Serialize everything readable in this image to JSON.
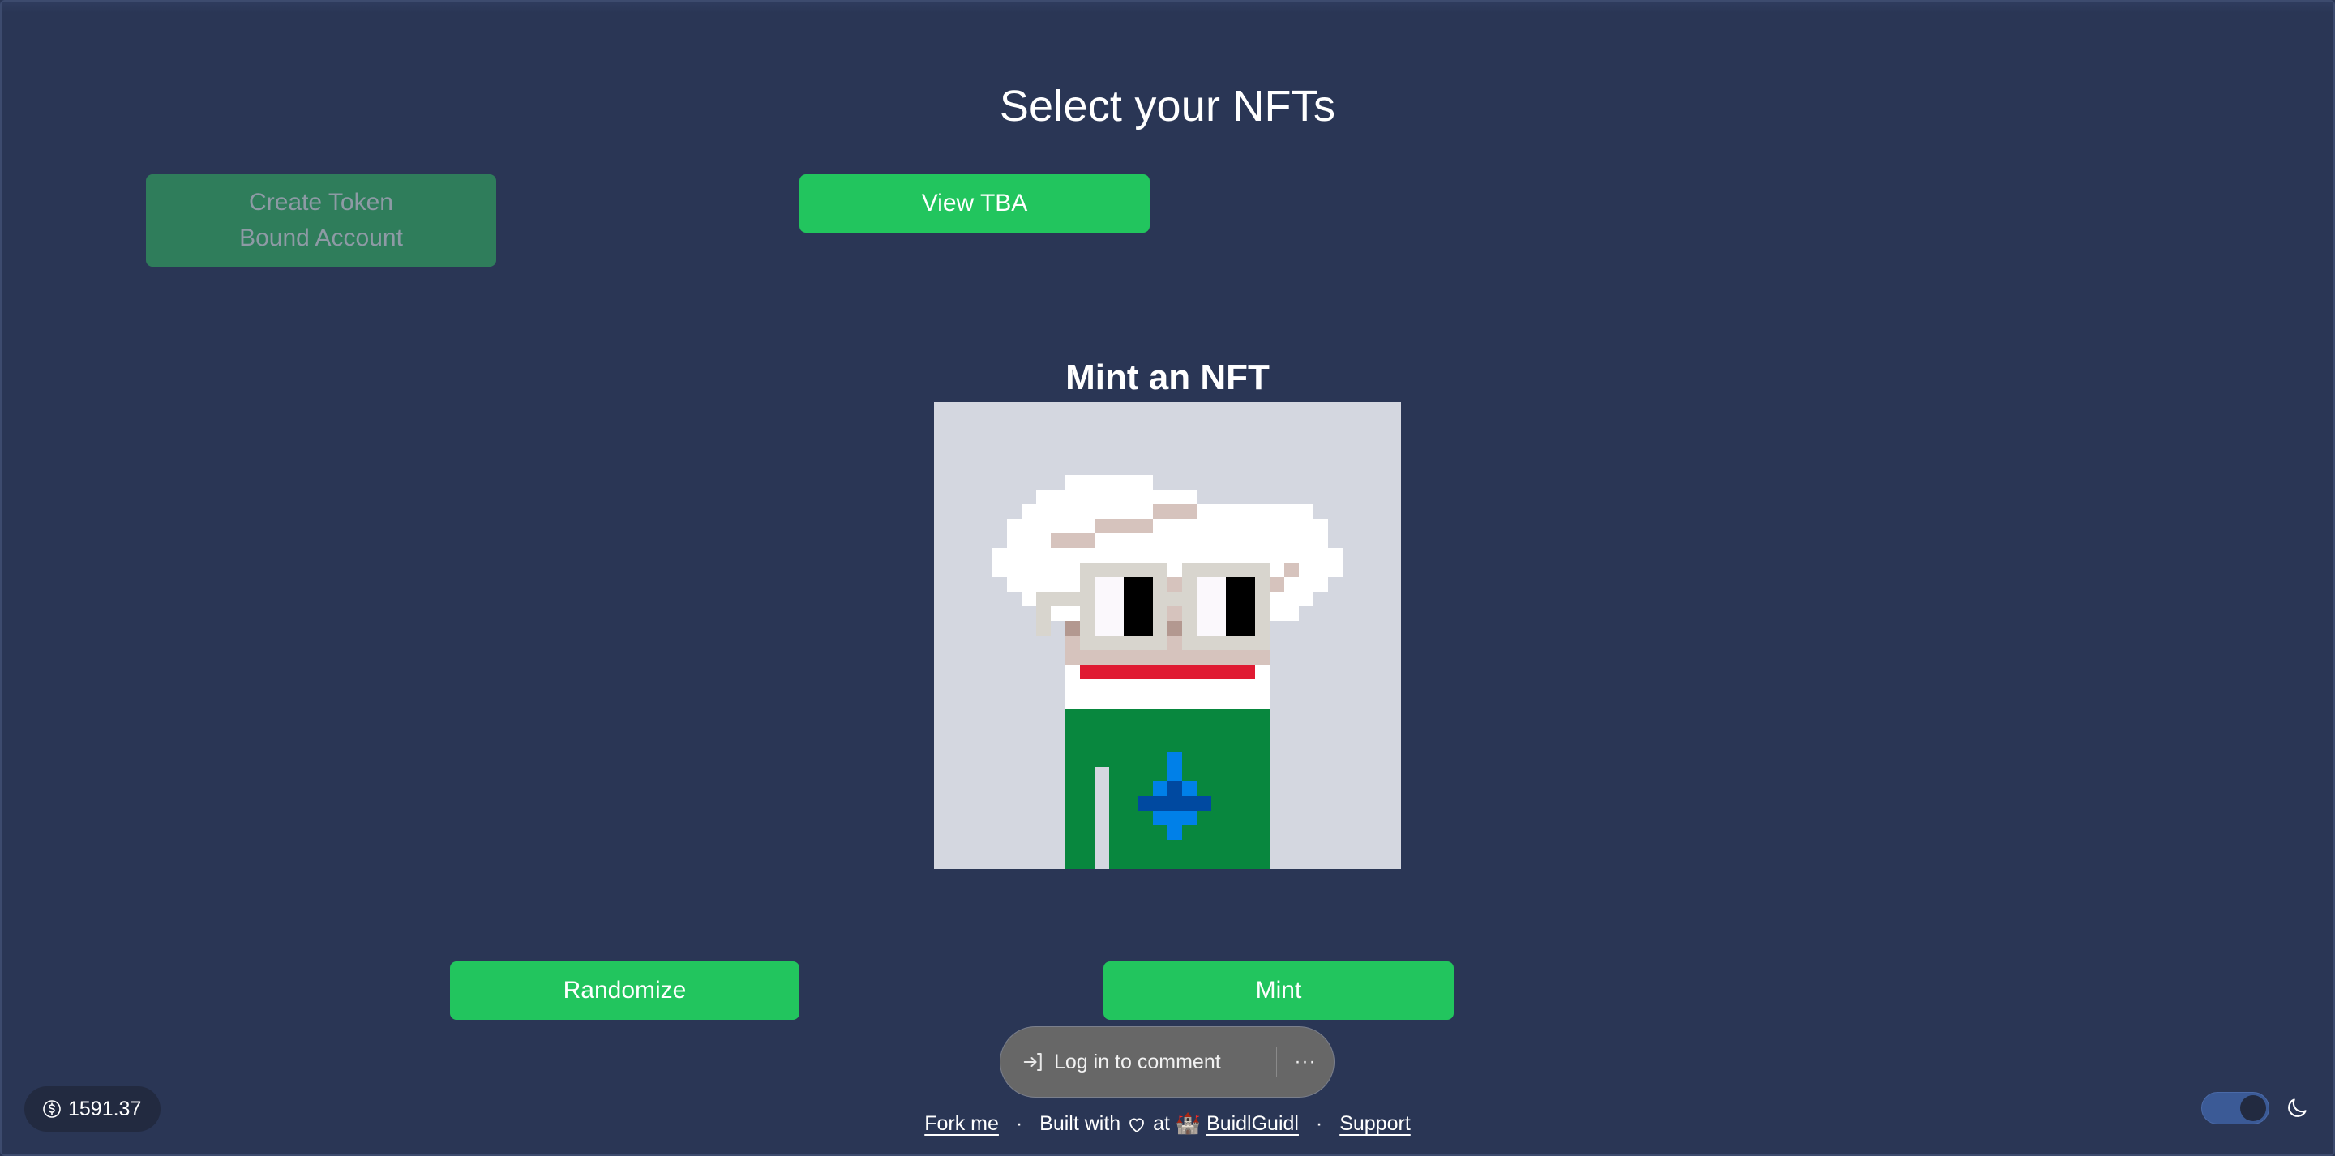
{
  "page": {
    "title": "Select your NFTs",
    "subtitle": "Mint an NFT"
  },
  "buttons": {
    "create_tba": "Create Token Bound Account",
    "create_tba_line1": "Create Token",
    "create_tba_line2": "Bound Account",
    "view_tba": "View TBA",
    "randomize": "Randomize",
    "mint": "Mint"
  },
  "comment_widget": {
    "login_label": "Log in to comment",
    "login_icon": "login-arrow-icon",
    "more_label": "···"
  },
  "footer": {
    "fork": "Fork me",
    "separator": "·",
    "built_with": "Built with",
    "heart_icon": "heart-icon",
    "at": "at",
    "castle_icon": "castle-emoji-icon",
    "castle": "🏰",
    "buidlguidl": "BuidlGuidl",
    "support": "Support"
  },
  "balance": {
    "icon": "dollar-circle-icon",
    "value": "1591.37"
  },
  "theme_toggle": {
    "mode": "dark",
    "icon": "moon-icon",
    "enabled": true
  },
  "colors": {
    "background": "#2a3655",
    "primary": "#22c55e",
    "primary_disabled": "#2f7d5b"
  },
  "nft": {
    "palette": {
      ".": "#d4d7e0",
      "W": "#ffffff",
      "T": "#d6c3bd",
      "F": "#d8d5ce",
      "E": "#fbf8fc",
      "K": "#000000",
      "D": "#b39890",
      "R": "#e01a32",
      "G": "#08873e",
      "B": "#0080e8",
      "N": "#0049a0"
    },
    "rows": [
      "................................",
      "................................",
      "................................",
      "................................",
      "................................",
      ".........WWWWWW.................",
      ".......WWWWWWWWWWW..............",
      "......WWWWWWWWWTTTWWWWWWWW......",
      ".....WWWWWWTTTTWWWWWWWWWWWW.....",
      ".....WWWTTTWWWWWWWWWWWWWWWW.....",
      "....WWWWWWWWWWWWWWWWWWWWWWWW....",
      "....WWWWWWFFFFFFWFFFFFFWTWWW....",
      ".....WWWWWFEEKKFTFEEKKFTWWW.....",
      "......WFFFFEEKKFFFEEKKFWWW......",
      ".......FWWFEEKKFTFEEKKFWW.......",
      ".......F.DFEEKKFDFEEKKF.........",
      ".........TFFFFFFTFFFFFF.........",
      ".........TTTTTTTTTTTTTT.........",
      ".........WRRRRRRRRRRRRW.........",
      ".........WWWWWWWWWWWWWW.........",
      ".........WWWWWWWWWWWWWW.........",
      ".........GGGGGGGGGGGGGG.........",
      ".........GGGGGGGGGGGGGG.........",
      ".........GGGGGGGGGGGGGG.........",
      ".........GGGGGGGBGGGGGG.........",
      ".........GG.GGGGBGGGGGG.........",
      ".........GG.GGGBNBGGGGG.........",
      ".........GG.GGNNNNNGGGG.........",
      ".........GG.GGGBBBGGGGG.........",
      ".........GG.GGGGBGGGGGG.........",
      ".........GG.GGGGGGGGGGG.........",
      ".........GG.GGGGGGGGGGG........."
    ]
  }
}
